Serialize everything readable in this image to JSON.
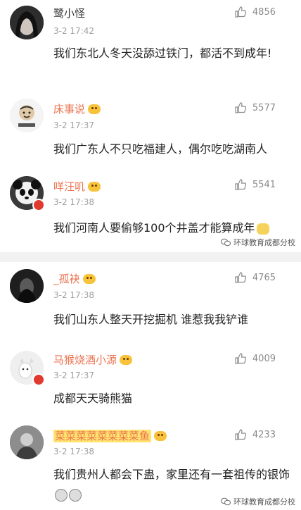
{
  "comments": [
    {
      "user": "鹭小怪",
      "time": "3-2 17:42",
      "likes": "4856",
      "text": "我们东北人冬天没舔过铁门，都活不到成年!"
    },
    {
      "user": "床事说",
      "time": "3-2 17:37",
      "likes": "5577",
      "text": "我们广东人不只吃福建人，偶尔吃吃湖南人"
    },
    {
      "user": "咩汪叽",
      "time": "3-2 17:38",
      "likes": "5541",
      "text": "我们河南人要偷够100个井盖才能算成年"
    },
    {
      "user": "_孤袂",
      "time": "3-2 17:38",
      "likes": "4765",
      "text": "我们山东人整天开挖掘机 谁惹我我铲谁"
    },
    {
      "user": "马猴烧酒小源",
      "time": "3-2 17:37",
      "likes": "4009",
      "text": "成都天天骑熊猫"
    },
    {
      "user": "菜菜菜菜菜菜菜菜鱼",
      "time": "3-2 17:38",
      "likes": "4233",
      "text": "我们贵州人都会下蛊，家里还有一套祖传的银饰"
    }
  ],
  "watermark": "环球教育成都分校",
  "icons": {
    "like": "thumbs-up-icon",
    "vip": "vip-emoji-badge-icon",
    "wechat": "wechat-icon"
  },
  "colors": {
    "username_vip": "#eb7350",
    "username_highlight_bg": "#ffe36e",
    "time": "#a0a0a0",
    "divider": "#f2f2f2"
  }
}
